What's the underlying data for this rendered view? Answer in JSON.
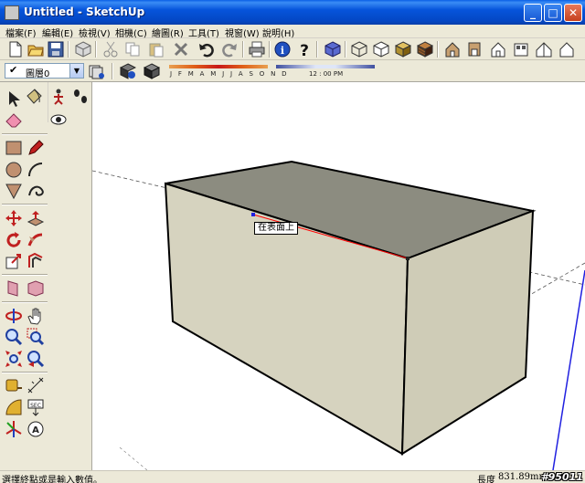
{
  "window": {
    "title": "Untitled - SketchUp",
    "controls": {
      "minimize": "_",
      "maximize": "□",
      "close": "✕"
    }
  },
  "menu": {
    "items": [
      "檔案(F)",
      "編輯(E)",
      "檢視(V)",
      "相機(C)",
      "繪圖(R)",
      "工具(T)",
      "視窗(W)",
      "說明(H)"
    ]
  },
  "toolbar": {
    "layer_label": "圖層0",
    "months_labels": "J F M A M J J A S O N D",
    "time_label": "12 : 00 PM",
    "icons": [
      "new-file-icon",
      "open-file-icon",
      "save-icon",
      "make-component-icon",
      "cut-icon",
      "copy-icon",
      "paste-icon",
      "erase-icon",
      "undo-icon",
      "redo-icon",
      "print-icon",
      "model-info-icon",
      "help-icon",
      "iso-view-icon",
      "wireframe-icon",
      "hidden-line-icon",
      "shaded-icon",
      "textured-icon",
      "iso-view-icon",
      "front-view-icon",
      "top-view-icon",
      "right-view-icon",
      "back-view-icon",
      "left-view-icon"
    ]
  },
  "viewport": {
    "inference_tooltip": "在表面上",
    "colors": {
      "edge": "#000000",
      "top_face": "#8c8c80",
      "front_face": "#d6d3bf",
      "side_face": "#cfccb7",
      "inference_line": "#ff0000",
      "axis_dashed": "#555555",
      "blue_axis": "#2020e0"
    }
  },
  "status": {
    "message": "選擇終點或是輸入數值。",
    "measure_label": "長度",
    "measure_value": "831.89mm",
    "watermark": "#95011"
  }
}
